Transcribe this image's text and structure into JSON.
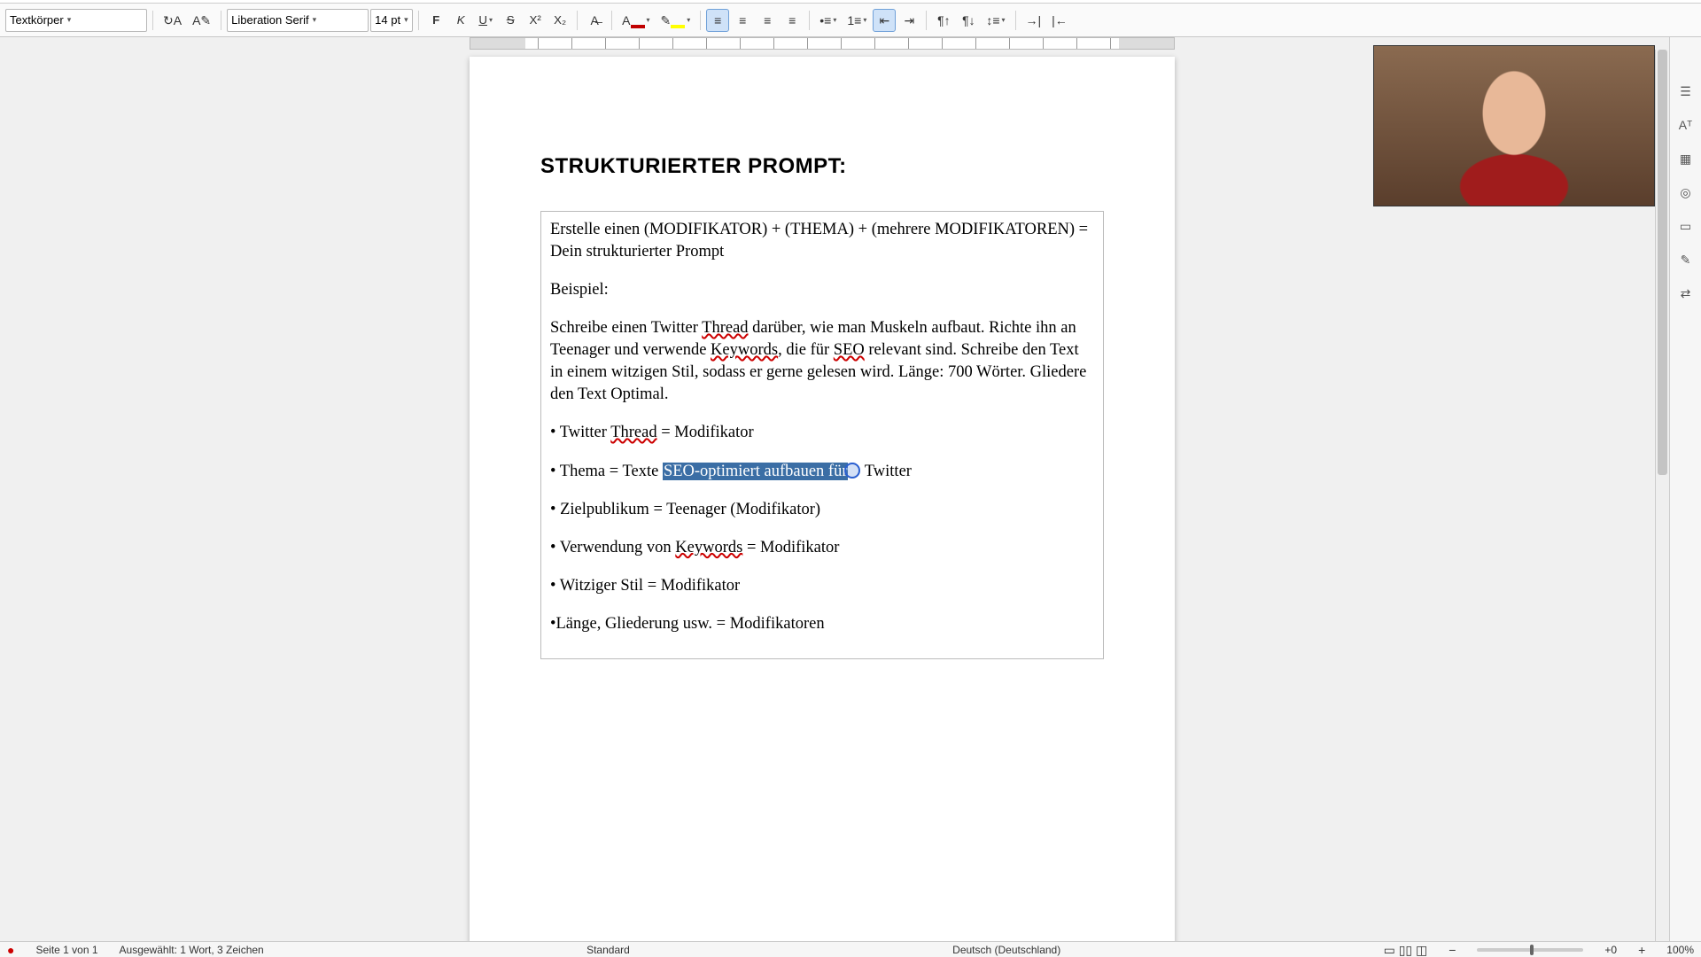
{
  "toolbar": {
    "paragraph_style": "Textkörper",
    "font_name": "Liberation Serif",
    "font_size": "14 pt",
    "bold": "F",
    "italic": "K",
    "underline": "U",
    "strike": "S",
    "superscript": "X²",
    "subscript": "X₂"
  },
  "document": {
    "heading": "STRUKTURIERTER PROMPT:",
    "intro": "Erstelle einen (MODIFIKATOR) + (THEMA) + (mehrere MODIFIKATOREN) = Dein strukturierter Prompt",
    "example_label": "Beispiel:",
    "example_body_1": "Schreibe einen Twitter ",
    "example_body_thread": "Thread",
    "example_body_2": " darüber, wie man Muskeln aufbaut. Richte ihn an Teenager und verwende ",
    "example_body_keywords": "Keywords",
    "example_body_3": ", die für ",
    "example_body_seo": "SEO",
    "example_body_4": " relevant sind. Schreibe den Text in einem witzigen Stil, sodass er gerne gelesen wird. Länge: 700 Wörter. Gliedere den Text Optimal.",
    "bullets": {
      "b1_pre": "• Twitter ",
      "b1_thread": "Thread",
      "b1_post": " = Modifikator",
      "b2_pre": "• Thema = Texte ",
      "b2_sel": "SEO-optimiert aufbauen für",
      "b2_post": " Twitter",
      "b3": "• Zielpublikum = Teenager (Modifikator)",
      "b4_pre": "• Verwendung von ",
      "b4_kw": "Keywords",
      "b4_post": " = Modifikator",
      "b5": "• Witziger Stil = Modifikator",
      "b6": "•Länge, Gliederung usw. = Modifikatoren"
    }
  },
  "statusbar": {
    "page": "Seite 1 von 1",
    "selection": "Ausgewählt: 1 Wort, 3 Zeichen",
    "page_style": "Standard",
    "language": "Deutsch (Deutschland)",
    "zoom": "100%"
  },
  "zoom_center_label": "+0"
}
